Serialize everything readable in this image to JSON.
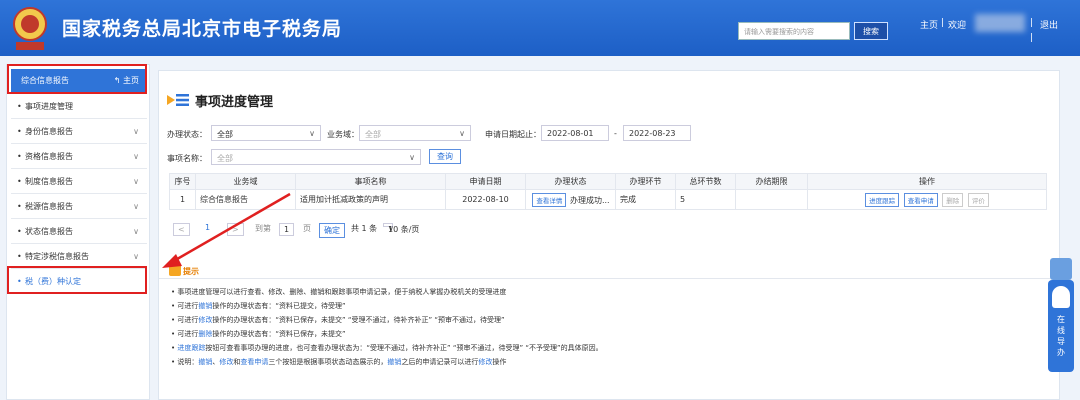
{
  "header": {
    "title": "国家税务总局北京市电子税务局",
    "search_placeholder": "请输入需要搜索的内容",
    "search_label": "搜索",
    "home": "主页",
    "sep": "|",
    "welcome": "欢迎",
    "logout": "退出"
  },
  "sidebar": {
    "head": "综合信息报告",
    "head_home": "主页",
    "items": [
      {
        "label": "事项进度管理",
        "has_chev": false
      },
      {
        "label": "身份信息报告",
        "has_chev": true
      },
      {
        "label": "资格信息报告",
        "has_chev": true
      },
      {
        "label": "制度信息报告",
        "has_chev": true
      },
      {
        "label": "税源信息报告",
        "has_chev": true
      },
      {
        "label": "状态信息报告",
        "has_chev": true
      },
      {
        "label": "特定涉税信息报告",
        "has_chev": true
      },
      {
        "label": "税（费）种认定",
        "has_chev": false
      }
    ],
    "dot": "•",
    "chev": "∨"
  },
  "main": {
    "title": "事项进度管理",
    "filters": {
      "status_label": "办理状态：",
      "status_value": "全部",
      "domain_label": "业务域：",
      "domain_value": "全部",
      "date_label": "申请日期起止：",
      "date_from": "2022-08-01",
      "date_sep": "-",
      "date_to": "2022-08-23",
      "name_label": "事项名称：",
      "name_value": "全部",
      "query": "查询"
    },
    "table": {
      "headers": [
        "序号",
        "业务域",
        "事项名称",
        "申请日期",
        "办理状态",
        "办理环节",
        "总环节数",
        "办结期限",
        "操作"
      ],
      "row": {
        "index": "1",
        "domain": "综合信息报告",
        "name": "适用加计抵减政策的声明",
        "date": "2022-08-10",
        "status_btn": "查看详情",
        "status_text": "办理成功...",
        "step": "完成",
        "total": "5",
        "deadline": "",
        "ops": [
          "进度跟踪",
          "查看申请",
          "删除",
          "评价"
        ]
      }
    },
    "pager": {
      "prev": "<",
      "page": "1",
      "next": ">",
      "goto": "到第",
      "goto_value": "1",
      "page_unit": "页",
      "confirm": "确定",
      "total": "共 1 条",
      "per_page": "10 条/页"
    },
    "tips": {
      "title": "提示",
      "lines": [
        {
          "parts": [
            {
              "t": "事项进度管理可以进行查看、修改、删除、撤销和跟踪事项申请记录，便于纳税人掌握办税机关的受理进度",
              "h": false
            }
          ]
        },
        {
          "parts": [
            {
              "t": "可进行",
              "h": false
            },
            {
              "t": "撤销",
              "h": true
            },
            {
              "t": "操作的办理状态有：“资料已提交，待受理”",
              "h": false
            }
          ]
        },
        {
          "parts": [
            {
              "t": "可进行",
              "h": false
            },
            {
              "t": "修改",
              "h": true
            },
            {
              "t": "操作的办理状态有：“资料已保存，未提交”  “受理不通过，待补齐补正”  “预审不通过，待受理”",
              "h": false
            }
          ]
        },
        {
          "parts": [
            {
              "t": "可进行",
              "h": false
            },
            {
              "t": "删除",
              "h": true
            },
            {
              "t": "操作的办理状态有：“资料已保存，未提交”",
              "h": false
            }
          ]
        },
        {
          "parts": [
            {
              "t": "进度跟踪",
              "h": true
            },
            {
              "t": "按钮可查看事项办理的进度，也可查看办理状态为：“受理不通过，待补齐补正”  “预审不通过，待受理”  “不予受理”的具体原因。",
              "h": false
            }
          ]
        },
        {
          "parts": [
            {
              "t": "说明：",
              "h": false
            },
            {
              "t": "撤销",
              "h": true
            },
            {
              "t": "、",
              "h": false
            },
            {
              "t": "修改",
              "h": true
            },
            {
              "t": "和",
              "h": false
            },
            {
              "t": "查看申请",
              "h": true
            },
            {
              "t": "三个按钮是根据事项状态动态展示的，",
              "h": false
            },
            {
              "t": "撤销",
              "h": true
            },
            {
              "t": "之后的申请记录可以进行",
              "h": false
            },
            {
              "t": "修改",
              "h": true
            },
            {
              "t": "操作",
              "h": false
            }
          ]
        }
      ]
    }
  },
  "float": {
    "guide": [
      "在",
      "线",
      "导",
      "办"
    ]
  },
  "colors": {
    "header": "#2f74d8",
    "highlight": "#e02020",
    "link": "#2f74d8"
  }
}
